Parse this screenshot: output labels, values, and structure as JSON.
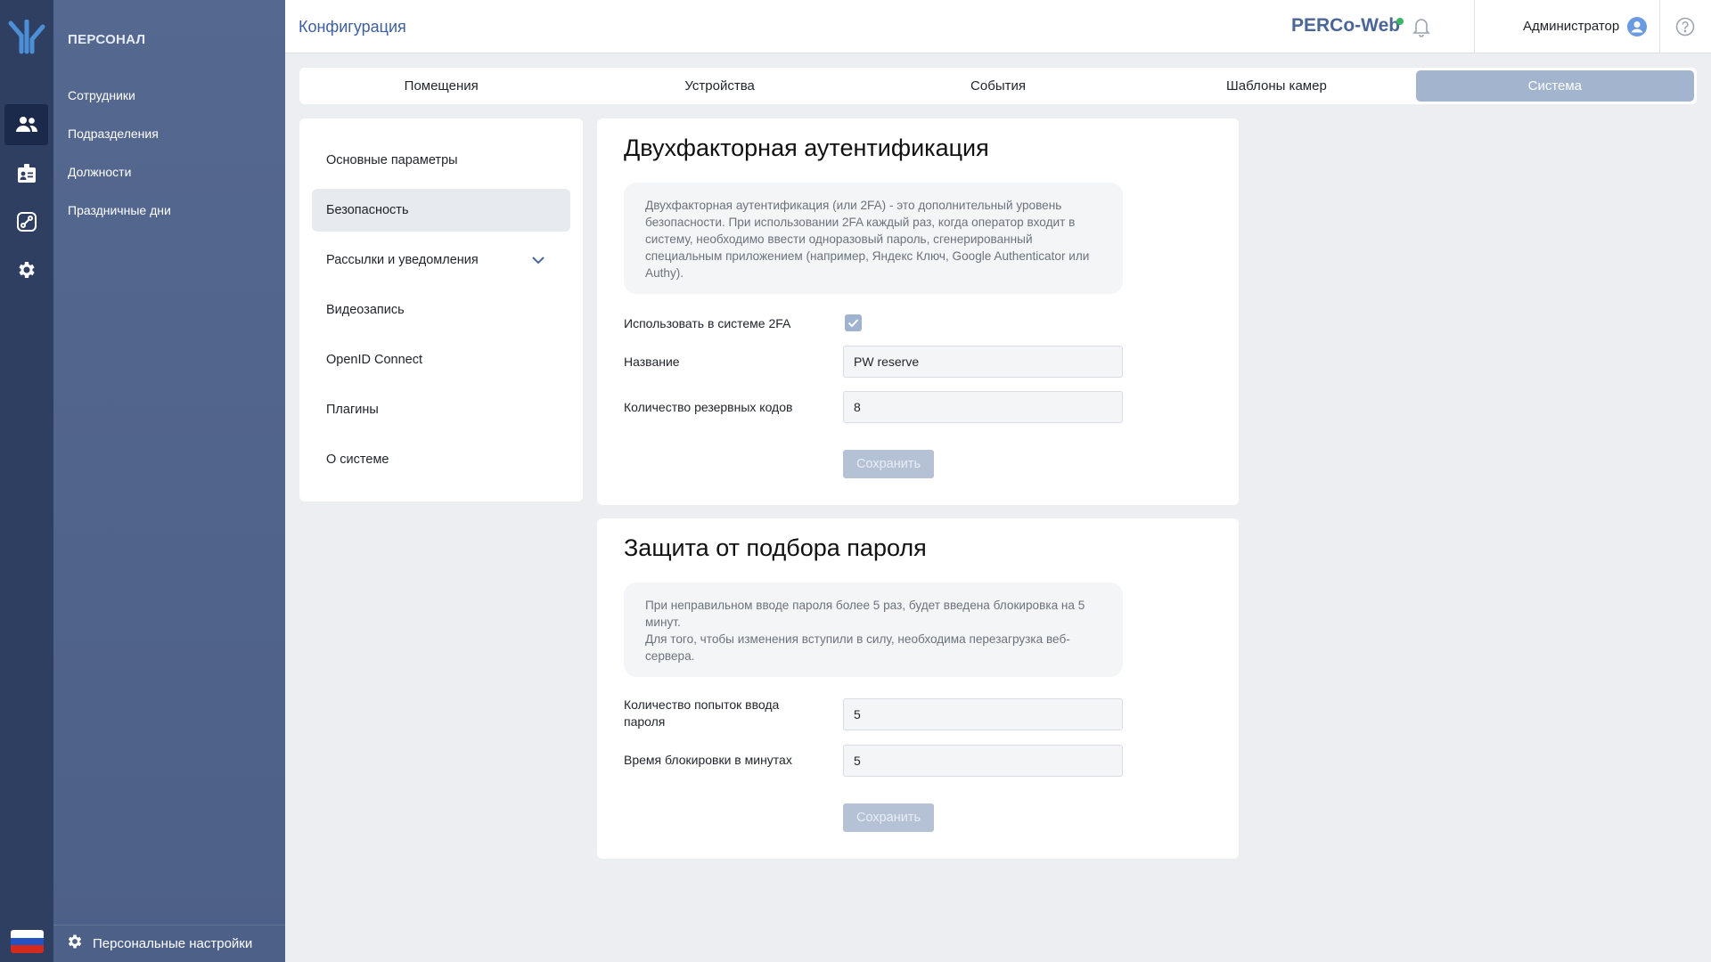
{
  "colors": {
    "rail_bg": "#2f3f62",
    "sidebar_bg": "#55688f",
    "accent": "#3d5f9e",
    "active_tab": "#a3b4cf",
    "brand_dot": "#3eb563"
  },
  "rail": {
    "items": [
      {
        "icon": "people-icon",
        "active": true
      },
      {
        "icon": "id-badge-icon",
        "active": false
      },
      {
        "icon": "route-icon",
        "active": false
      },
      {
        "icon": "gear-icon",
        "active": false
      }
    ],
    "language_flag": "russian-flag-icon"
  },
  "sidebar": {
    "section_title": "ПЕРСОНАЛ",
    "items": [
      {
        "label": "Сотрудники"
      },
      {
        "label": "Подразделения"
      },
      {
        "label": "Должности"
      },
      {
        "label": "Праздничные дни"
      }
    ],
    "footer_label": "Персональные настройки"
  },
  "header": {
    "title": "Конфигурация",
    "brand": "PERCo-Web",
    "user_name": "Администратор"
  },
  "tabs": [
    {
      "label": "Помещения",
      "active": false
    },
    {
      "label": "Устройства",
      "active": false
    },
    {
      "label": "События",
      "active": false
    },
    {
      "label": "Шаблоны камер",
      "active": false
    },
    {
      "label": "Система",
      "active": true
    }
  ],
  "settings_menu": [
    {
      "label": "Основные параметры",
      "active": false
    },
    {
      "label": "Безопасность",
      "active": true
    },
    {
      "label": "Рассылки и уведомления",
      "active": false,
      "expandable": true
    },
    {
      "label": "Видеозапись",
      "active": false
    },
    {
      "label": "OpenID Connect",
      "active": false
    },
    {
      "label": "Плагины",
      "active": false
    },
    {
      "label": "О системе",
      "active": false
    }
  ],
  "two_factor": {
    "title": "Двухфакторная аутентификация",
    "info": "Двухфакторная аутентификация (или 2FA) - это дополнительный уровень безопасности. При использовании 2FA каждый раз, когда оператор входит в систему, необходимо ввести одноразовый пароль, сгенерированный специальным приложением (например, Яндекс Ключ, Google Authenticator или Authy).",
    "use_2fa_label": "Использовать в системе 2FA",
    "use_2fa_checked": true,
    "name_label": "Название",
    "name_value": "PW reserve",
    "backup_codes_label": "Количество резервных кодов",
    "backup_codes_value": "8",
    "save_label": "Сохранить"
  },
  "brute_force": {
    "title": "Защита от подбора пароля",
    "info": "При неправильном вводе пароля более 5 раз, будет введена блокировка на 5 минут.\nДля того, чтобы изменения вступили в силу, необходима перезагрузка веб-сервера.",
    "attempts_label": "Количество попыток ввода пароля",
    "attempts_value": "5",
    "lock_time_label": "Время блокировки в минутах",
    "lock_time_value": "5",
    "save_label": "Сохранить"
  }
}
